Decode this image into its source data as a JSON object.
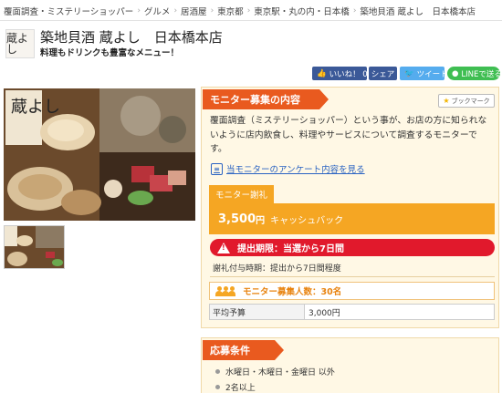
{
  "breadcrumb": [
    "覆面調査・ミステリーショッパー",
    "グルメ",
    "居酒屋",
    "東京都",
    "東京駅・丸の内・日本橋",
    "築地貝酒 蔵よし　日本橋本店"
  ],
  "shop": {
    "logo_text": "蔵よし",
    "title": "築地貝酒 蔵よし　日本橋本店",
    "subtitle": "料理もドリンクも豊富なメニュー！"
  },
  "social": {
    "like_label": "いいね！ 0",
    "share_label": "シェア",
    "tweet_label": "ツイート",
    "line_label": "LINEで送る"
  },
  "photos": {
    "main_sign_text": "蔵よし"
  },
  "monitor": {
    "heading": "モニター募集の内容",
    "bookmark_label": "ブックマーク",
    "description": "覆面調査（ミステリーショッパー）という事が、お店の方に知られないように店内飲食し、料理やサービスについて調査するモニターです。",
    "survey_link": "当モニターのアンケート内容を見る",
    "reward_tab": "モニター謝礼",
    "reward_amount": "3,500",
    "reward_yen": "円",
    "reward_type": "キャッシュバック",
    "deadline": "提出期限：当選から7日間",
    "reward_time": "謝礼付与時期：提出から7日間程度",
    "recruit": "モニター募集人数：30名",
    "budget_label": "平均予算",
    "budget_value": "3,000円"
  },
  "conditions": {
    "heading": "応募条件",
    "items": [
      "水曜日・木曜日・金曜日 以外",
      "2名以上"
    ]
  },
  "colors": {
    "accent_orange": "#e95a1f",
    "reward_orange": "#f5a623",
    "deadline_red": "#e1192c",
    "facebook": "#3b5998",
    "twitter": "#55acee",
    "line": "#3fbe52"
  }
}
